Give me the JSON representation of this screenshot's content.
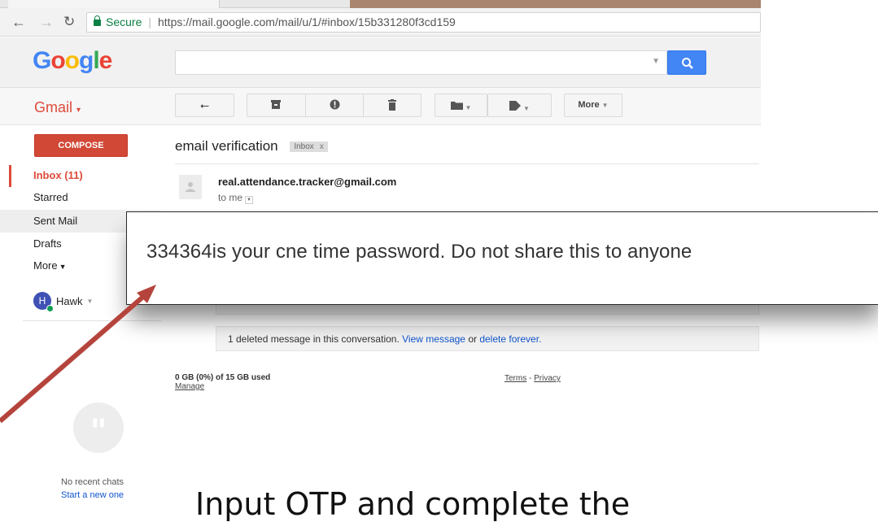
{
  "browser": {
    "secure_label": "Secure",
    "url": "https://mail.google.com/mail/u/1/#inbox/15b331280f3cd159"
  },
  "gmail": {
    "logo_letters": [
      "G",
      "o",
      "o",
      "g",
      "l",
      "e"
    ],
    "logo_colors": [
      "#4285f4",
      "#ea4335",
      "#fbbc05",
      "#4285f4",
      "#34a853",
      "#ea4335"
    ],
    "search_placeholder": "",
    "app_menu_label": "Gmail",
    "toolbar": {
      "more_label": "More"
    }
  },
  "sidebar": {
    "compose_label": "COMPOSE",
    "items": [
      {
        "label": "Inbox (11)"
      },
      {
        "label": "Starred"
      },
      {
        "label": "Sent Mail"
      },
      {
        "label": "Drafts"
      },
      {
        "label": "More"
      }
    ],
    "account": {
      "initial": "H",
      "name": "Hawk"
    }
  },
  "message": {
    "subject": "email verification",
    "label": "Inbox",
    "label_remove": "x",
    "sender": "real.attendance.tracker@gmail.com",
    "recipient": "to me",
    "deleted_notice": "1 deleted message in this conversation.",
    "view_link": "View message",
    "or_text": "or",
    "delete_link": "delete forever."
  },
  "footer": {
    "storage": "0 GB (0%) of 15 GB used",
    "manage": "Manage",
    "terms": "Terms",
    "dash": "-",
    "privacy": "Privacy"
  },
  "chat": {
    "no_recent": "No recent chats",
    "start_new": "Start a new one"
  },
  "callout": {
    "text": "334364is your cne time password. Do not share this to anyone"
  },
  "caption": {
    "text": "Input OTP and complete the"
  },
  "colors": {
    "gmail_red": "#dd4b39",
    "compose_red": "#d14836",
    "link_blue": "#1155cc",
    "search_blue": "#4285f4",
    "arrow": "#b5443c"
  }
}
